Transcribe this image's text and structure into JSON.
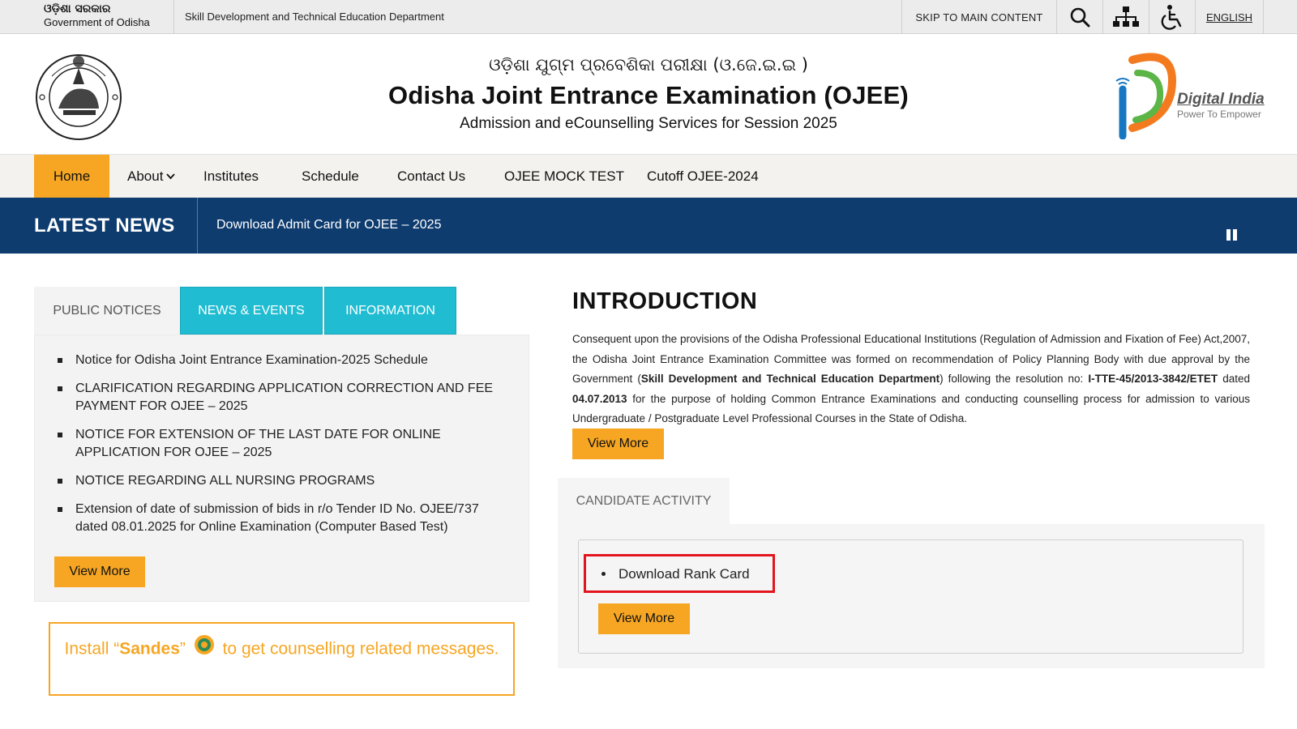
{
  "topbar": {
    "gov_odia": "ଓଡ଼ିଶା ସରକାର",
    "gov_english": "Government of Odisha",
    "department": "Skill Development and Technical Education Department",
    "skip_link": "SKIP TO MAIN CONTENT",
    "language": "ENGLISH",
    "icons": [
      "search-icon",
      "sitemap-icon",
      "accessibility-icon"
    ]
  },
  "header": {
    "title_odia": "ଓଡ଼ିଶା ଯୁଗ୍ମ ପ୍ରବେଶିକା ପରୀକ୍ଷା (ଓ.ଜେ.ଇ.ଇ )",
    "title": "Odisha Joint Entrance Examination (OJEE)",
    "subtitle": "Admission and eCounselling Services for Session 2025",
    "digital_india": "Digital India",
    "digital_india_tagline": "Power To Empower"
  },
  "nav": {
    "items": [
      {
        "label": "Home",
        "active": true
      },
      {
        "label": "About",
        "has_dropdown": true
      },
      {
        "label": "Institutes"
      },
      {
        "label": "Schedule"
      },
      {
        "label": "Contact Us"
      },
      {
        "label": "OJEE MOCK TEST"
      },
      {
        "label": "Cutoff OJEE-2024"
      }
    ]
  },
  "latest_news": {
    "label": "LATEST NEWS",
    "ticker": "Download Admit Card for OJEE – 2025"
  },
  "notices": {
    "tabs": [
      "PUBLIC NOTICES",
      "NEWS & EVENTS",
      "INFORMATION"
    ],
    "active_tab": "PUBLIC NOTICES",
    "items": [
      "Notice for Odisha Joint Entrance Examination-2025 Schedule",
      "CLARIFICATION REGARDING APPLICATION CORRECTION AND FEE PAYMENT FOR OJEE – 2025",
      "NOTICE FOR EXTENSION OF THE LAST DATE FOR ONLINE APPLICATION FOR OJEE – 2025",
      "NOTICE REGARDING ALL NURSING PROGRAMS",
      "Extension of date of submission of bids in r/o Tender ID No. OJEE/737 dated 08.01.2025 for Online Examination (Computer Based Test)"
    ],
    "view_more": "View More"
  },
  "sandes": {
    "prefix": "Install “",
    "app_name": "Sandes",
    "suffix_quote": "”",
    "rest": "to get counselling related messages."
  },
  "introduction": {
    "heading": "INTRODUCTION",
    "text_1": "Consequent upon the provisions of the Odisha Professional Educational Institutions (Regulation of Admission and Fixation of Fee) Act,2007, the Odisha Joint Entrance Examination Committee was formed on recommendation of Policy Planning Body with due approval by the Government (",
    "text_bold_1": "Skill Development and Technical Education Department",
    "text_2": ") following the resolution no: ",
    "text_bold_2": "I-TTE-45/2013-3842/ETET",
    "text_3": " dated ",
    "text_bold_3": "04.07.2013",
    "text_4": " for the purpose of holding Common Entrance Examinations and conducting counselling process for admission to various Undergraduate / Postgraduate Level Professional Courses in the State of Odisha.",
    "view_more": "View More"
  },
  "candidate_activity": {
    "tab": "CANDIDATE ACTIVITY",
    "items": [
      "Download Rank Card"
    ],
    "highlight_color": "#e3141e",
    "view_more": "View More"
  },
  "colors": {
    "accent_orange": "#f6a623",
    "news_bar": "#0e3c6f",
    "tab_cyan": "#1fbcd2"
  }
}
